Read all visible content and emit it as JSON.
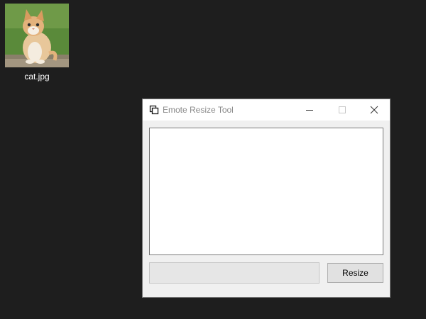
{
  "desktop": {
    "icon": {
      "label": "cat.jpg",
      "icon_name": "cat-image-thumbnail"
    }
  },
  "window": {
    "title": "Emote Resize Tool",
    "app_icon": "app-window-icon",
    "controls": {
      "minimize_icon": "minimize-icon",
      "maximize_icon": "maximize-icon",
      "close_icon": "close-icon"
    },
    "preview_area": {
      "content": ""
    },
    "name_field": {
      "value": "",
      "placeholder": ""
    },
    "resize_button": {
      "label": "Resize"
    }
  },
  "colors": {
    "desktop_bg": "#1e1e1e",
    "window_bg": "#f0f0f0",
    "titlebar_bg": "#ffffff",
    "title_text": "#8a8a8a"
  }
}
